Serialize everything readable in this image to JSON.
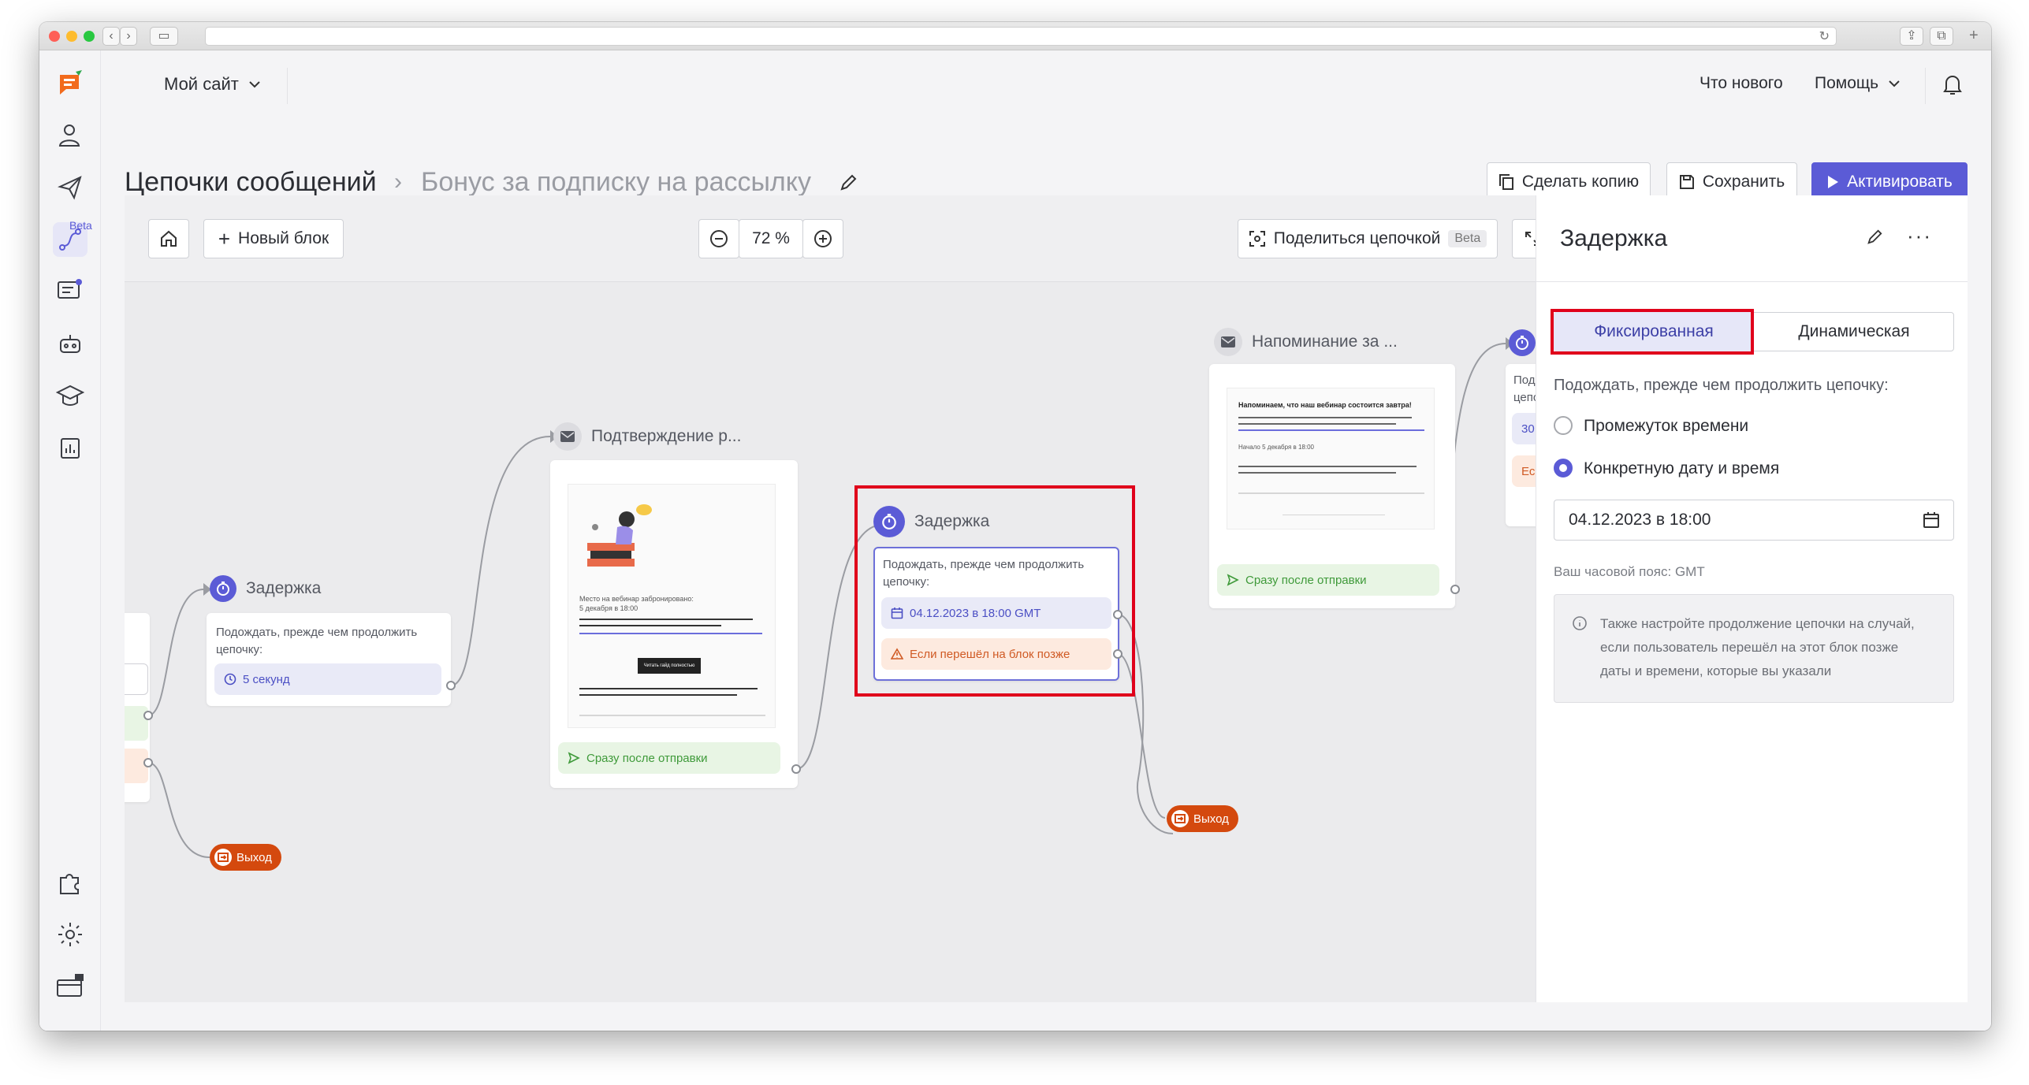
{
  "app": {
    "site_selector": "Мой сайт",
    "whats_new": "Что нового",
    "help": "Помощь",
    "beta_badge": "Beta"
  },
  "page": {
    "breadcrumb_root": "Цепочки сообщений",
    "breadcrumb_current": "Бонус за подписку на рассылку",
    "copy_button": "Сделать копию",
    "save_button": "Сохранить",
    "activate_button": "Активировать"
  },
  "toolbar": {
    "new_block": "Новый блок",
    "zoom": "72 %",
    "share": "Поделиться цепочкой",
    "share_badge": "Beta"
  },
  "nodes": {
    "delay1": {
      "title": "Задержка",
      "text": "Подождать, прежде чем продолжить цепочку:",
      "value": "5 секунд"
    },
    "exit1": "Выход",
    "email1": {
      "title": "Подтверждение р...",
      "preview_line1": "Место на вебинар забронировано:",
      "preview_line2": "5 декабря в 18:00",
      "preview_button": "Читать гайд полностью",
      "after_send": "Сразу после отправки"
    },
    "delay2": {
      "title": "Задержка",
      "text": "Подождать, прежде чем продолжить цепочку:",
      "value": "04.12.2023 в 18:00 GMT",
      "late_branch": "Если перешёл на блок позже"
    },
    "exit2": "Выход",
    "email2": {
      "title": "Напоминание за ...",
      "preview_heading": "Напоминаем, что наш вебинар состоится завтра!",
      "preview_line": "Начало 5 декабря в 18:00",
      "after_send": "Сразу после отправки"
    },
    "delay3": {
      "text_partial": "Подож",
      "text_partial2": "цепочк",
      "value_partial": "30",
      "late_partial": "Ес"
    }
  },
  "panel": {
    "title": "Задержка",
    "tab_fixed": "Фиксированная",
    "tab_dynamic": "Динамическая",
    "prompt": "Подождать, прежде чем продолжить цепочку:",
    "option_interval": "Промежуток времени",
    "option_datetime": "Конкретную дату и время",
    "date_value": "04.12.2023 в 18:00",
    "timezone": "Ваш часовой пояс: GMT",
    "info": "Также настройте продолжение цепочки на случай, если пользователь перешёл на этот блок позже даты и времени, которые вы указали"
  },
  "colors": {
    "accent": "#5b5bd6",
    "highlight": "#e0001b",
    "exit": "#d4490e",
    "success": "#3f9a3a",
    "warning": "#d05a24"
  }
}
